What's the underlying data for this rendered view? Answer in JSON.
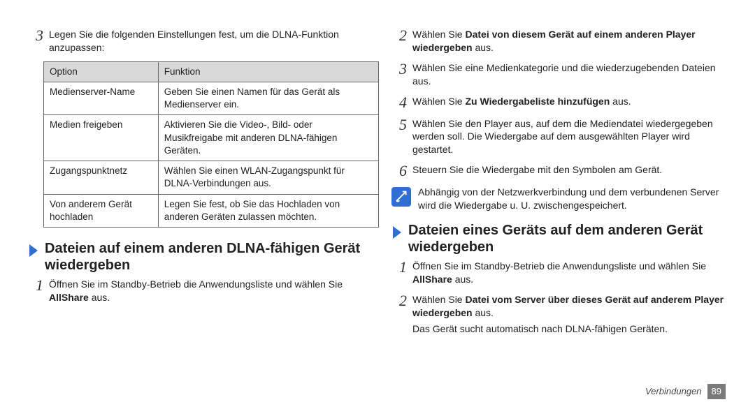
{
  "left": {
    "step3": "Legen Sie die folgenden Einstellungen fest, um die DLNA-Funktion anzupassen:",
    "table": {
      "head": {
        "c1": "Option",
        "c2": "Funktion"
      },
      "rows": [
        {
          "c1": "Medienserver-Name",
          "c2": "Geben Sie einen Namen für das Gerät als Medienserver ein."
        },
        {
          "c1": "Medien freigeben",
          "c2": "Aktivieren Sie die Video-, Bild- oder Musikfreigabe mit anderen DLNA-fähigen Geräten."
        },
        {
          "c1": "Zugangspunktnetz",
          "c2": "Wählen Sie einen WLAN-Zugangspunkt für DLNA-Verbindungen aus."
        },
        {
          "c1": "Von anderem Gerät hochladen",
          "c2": "Legen Sie fest, ob Sie das Hochladen von anderen Geräten zulassen möchten."
        }
      ]
    },
    "subhead": "Dateien auf einem anderen DLNA-fähigen Gerät wiedergeben",
    "step1a": "Öffnen Sie im Standby-Betrieb die Anwendungsliste und wählen Sie ",
    "step1b": "AllShare",
    "step1c": " aus."
  },
  "right": {
    "step2a": "Wählen Sie ",
    "step2b": "Datei von diesem Gerät auf einem anderen Player wiedergeben",
    "step2c": " aus.",
    "step3": "Wählen Sie eine Medienkategorie und die wiederzugebenden Dateien aus.",
    "step4a": "Wählen Sie ",
    "step4b": "Zu Wiedergabeliste hinzufügen",
    "step4c": " aus.",
    "step5": "Wählen Sie den Player aus, auf dem die Mediendatei wiedergegeben werden soll. Die Wiedergabe auf dem ausgewählten Player wird gestartet.",
    "step6": "Steuern Sie die Wiedergabe mit den Symbolen am Gerät.",
    "note": "Abhängig von der Netzwerkverbindung und dem verbundenen Server wird die Wiedergabe u. U. zwischengespeichert.",
    "subhead": "Dateien eines Geräts auf dem anderen Gerät wiedergeben",
    "b_step1a": "Öffnen Sie im Standby-Betrieb die Anwendungsliste und wählen Sie ",
    "b_step1b": "AllShare",
    "b_step1c": " aus.",
    "b_step2a": "Wählen Sie ",
    "b_step2b": "Datei vom Server über dieses Gerät auf anderem Player wiedergeben",
    "b_step2c": " aus.",
    "b_after": "Das Gerät sucht automatisch nach DLNA-fähigen Geräten."
  },
  "footer": {
    "section": "Verbindungen",
    "page": "89"
  }
}
